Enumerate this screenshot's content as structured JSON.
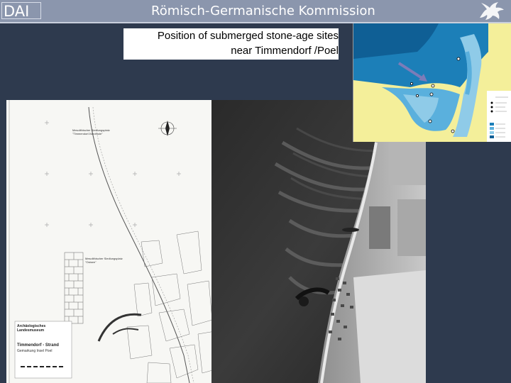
{
  "header": {
    "logo_text": "DAI",
    "organization": "Römisch-Germanische Kommission",
    "emblem_icon": "griffin-emblem-icon"
  },
  "slide": {
    "title_line1": "Position of submerged stone-age sites",
    "title_line2": "near Timmendorf /Poel"
  },
  "plan_map": {
    "site_label_1": "Mesolithischer Siedlungsplatz \"Timmendorf-Nordmole\"",
    "site_label_2": "Mesolithischer Siedlungsplatz \"Ostsee\"",
    "legend_org": "Archäologisches Landesmuseum",
    "legend_title": "Timmendorf - Strand",
    "legend_subtitle": "Gemarkung Insel Poel"
  },
  "colors": {
    "background": "#2e3a4e",
    "header": "#8b96ad",
    "sea_deep": "#1c7fb8",
    "sea_shallow": "#8fcbe8",
    "land": "#f4ef9a"
  }
}
